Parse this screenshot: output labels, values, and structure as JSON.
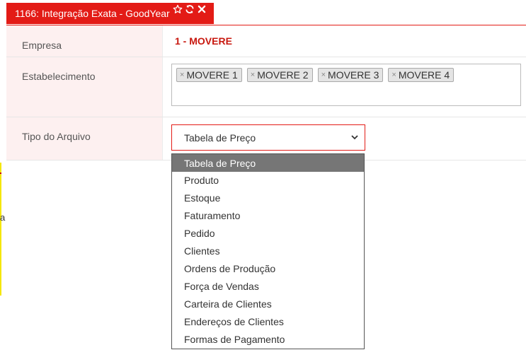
{
  "tab": {
    "title": "1166: Integração Exata - GoodYear"
  },
  "form": {
    "company_label": "Empresa",
    "company_value": "1 - MOVERE",
    "establishment_label": "Estabelecimento",
    "establishments": [
      "MOVERE 1",
      "MOVERE 2",
      "MOVERE 3",
      "MOVERE 4"
    ],
    "tag_remove_symbol": "×",
    "file_type_label": "Tipo do Arquivo",
    "file_type_value": "Tabela de Preço"
  },
  "dropdown": {
    "options": [
      "Tabela de Preço",
      "Produto",
      "Estoque",
      "Faturamento",
      "Pedido",
      "Clientes",
      "Ordens de Produção",
      "Força de Vendas",
      "Carteira de Clientes",
      "Endereços de Clientes",
      "Formas de Pagamento"
    ],
    "selected_index": 0
  },
  "edge_fragment": "a",
  "colors": {
    "brand_red": "#e31b16",
    "company_text": "#c8180f",
    "label_background": "#fdf0f0",
    "selected_option": "#767676",
    "edge_yellow": "#f5e600"
  },
  "icons": [
    "star-icon",
    "refresh-icon",
    "close-icon",
    "chevron-down-icon"
  ]
}
